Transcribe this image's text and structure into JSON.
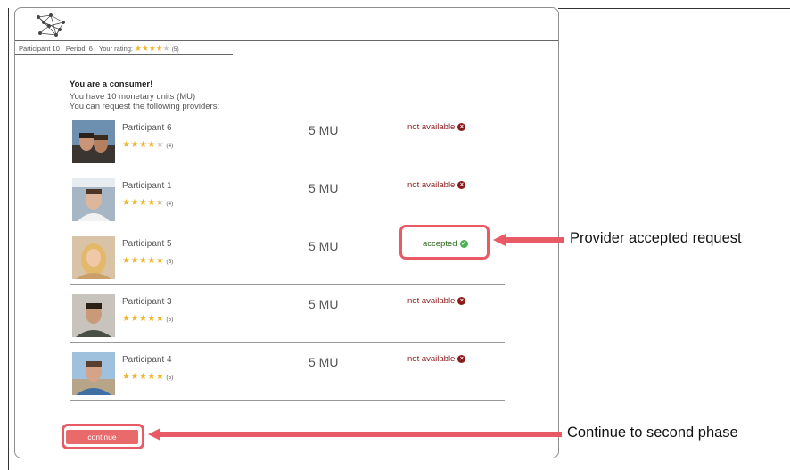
{
  "header": {
    "participant": "Participant 10",
    "period": "Period: 6",
    "rating_label": "Your rating:",
    "rating_count": "(5)",
    "rating_value": 4
  },
  "intro": {
    "title": "You are a consumer!",
    "balance": "You have 10 monetary units (MU)",
    "instruction": "You can request the following providers:"
  },
  "providers": [
    {
      "name": "Participant 6",
      "rating": 4,
      "rating_count": "(4)",
      "price": "5 MU",
      "status": "not available"
    },
    {
      "name": "Participant 1",
      "rating": 4.5,
      "rating_count": "(4)",
      "price": "5 MU",
      "status": "not available"
    },
    {
      "name": "Participant 5",
      "rating": 5,
      "rating_count": "(5)",
      "price": "5 MU",
      "status": "accepted"
    },
    {
      "name": "Participant 3",
      "rating": 5,
      "rating_count": "(5)",
      "price": "5 MU",
      "status": "not available"
    },
    {
      "name": "Participant 4",
      "rating": 5,
      "rating_count": "(5)",
      "price": "5 MU",
      "status": "not available"
    }
  ],
  "continue_label": "continue",
  "annotations": {
    "accepted": "Provider accepted request",
    "continue": "Continue to second phase"
  },
  "colors": {
    "star": "#f0b429",
    "not_available": "#8b1a1a",
    "accepted": "#2e6b1f",
    "button": "#e86a6a",
    "annotation": "#e85a66"
  }
}
